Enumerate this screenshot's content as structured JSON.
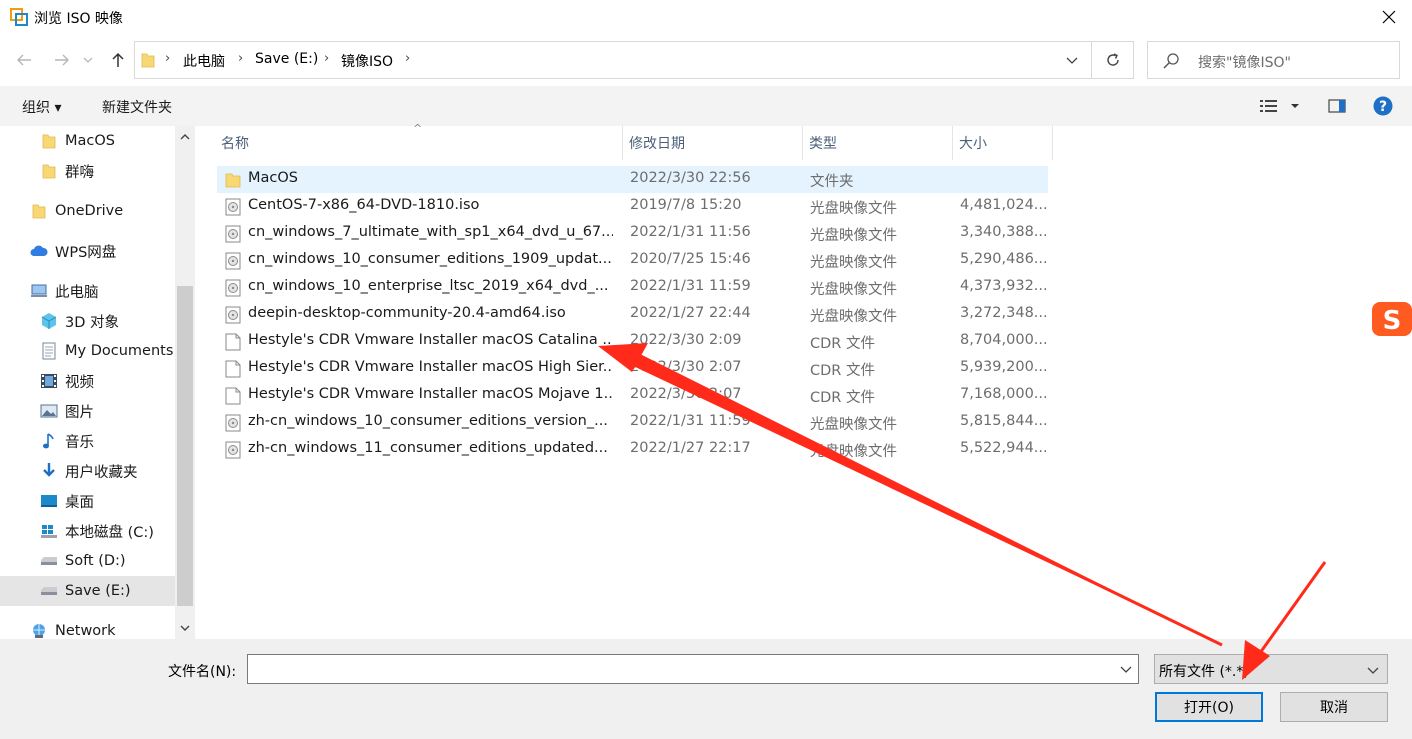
{
  "window": {
    "title": "浏览 ISO 映像"
  },
  "address": {
    "crumbs": [
      "此电脑",
      "Save (E:)",
      "镜像ISO"
    ]
  },
  "search": {
    "placeholder": "搜索\"镜像ISO\""
  },
  "toolbar": {
    "organize": "组织 ▾",
    "new_folder": "新建文件夹"
  },
  "nav": {
    "items": [
      {
        "label": "MacOS",
        "icon": "folder-icon"
      },
      {
        "label": "群嗨",
        "icon": "folder-icon"
      },
      {
        "label": "OneDrive",
        "icon": "folder-icon"
      },
      {
        "label": "WPS网盘",
        "icon": "cloud-icon"
      },
      {
        "label": "此电脑",
        "icon": "computer-icon"
      },
      {
        "label": "3D 对象",
        "icon": "cube-icon"
      },
      {
        "label": "My Documents",
        "icon": "document-icon"
      },
      {
        "label": "视频",
        "icon": "film-icon"
      },
      {
        "label": "图片",
        "icon": "picture-icon"
      },
      {
        "label": "音乐",
        "icon": "music-icon"
      },
      {
        "label": "用户收藏夹",
        "icon": "download-arrow-icon"
      },
      {
        "label": "桌面",
        "icon": "desktop-icon"
      },
      {
        "label": "本地磁盘 (C:)",
        "icon": "windows-drive-icon"
      },
      {
        "label": "Soft (D:)",
        "icon": "drive-icon"
      },
      {
        "label": "Save (E:)",
        "icon": "drive-icon"
      },
      {
        "label": "Network",
        "icon": "network-icon"
      }
    ]
  },
  "columns": {
    "name": "名称",
    "date": "修改日期",
    "type": "类型",
    "size": "大小"
  },
  "files": [
    {
      "name": "MacOS",
      "date": "2022/3/30 22:56",
      "type": "文件夹",
      "size": "",
      "icon": "folder-icon"
    },
    {
      "name": "CentOS-7-x86_64-DVD-1810.iso",
      "date": "2019/7/8 15:20",
      "type": "光盘映像文件",
      "size": "4,481,024...",
      "icon": "disc-image-icon"
    },
    {
      "name": "cn_windows_7_ultimate_with_sp1_x64_dvd_u_67...",
      "date": "2022/1/31 11:56",
      "type": "光盘映像文件",
      "size": "3,340,388...",
      "icon": "disc-image-icon"
    },
    {
      "name": "cn_windows_10_consumer_editions_1909_updat...",
      "date": "2020/7/25 15:46",
      "type": "光盘映像文件",
      "size": "5,290,486...",
      "icon": "disc-image-icon"
    },
    {
      "name": "cn_windows_10_enterprise_ltsc_2019_x64_dvd_...",
      "date": "2022/1/31 11:59",
      "type": "光盘映像文件",
      "size": "4,373,932...",
      "icon": "disc-image-icon"
    },
    {
      "name": "deepin-desktop-community-20.4-amd64.iso",
      "date": "2022/1/27 22:44",
      "type": "光盘映像文件",
      "size": "3,272,348...",
      "icon": "disc-image-icon"
    },
    {
      "name": "Hestyle's CDR Vmware Installer macOS Catalina ...",
      "date": "2022/3/30 2:09",
      "type": "CDR 文件",
      "size": "8,704,000...",
      "icon": "file-icon"
    },
    {
      "name": "Hestyle's CDR Vmware Installer macOS High Sier...",
      "date": "2022/3/30 2:07",
      "type": "CDR 文件",
      "size": "5,939,200...",
      "icon": "file-icon"
    },
    {
      "name": "Hestyle's CDR Vmware Installer macOS Mojave 1...",
      "date": "2022/3/30 2:07",
      "type": "CDR 文件",
      "size": "7,168,000...",
      "icon": "file-icon"
    },
    {
      "name": "zh-cn_windows_10_consumer_editions_version_...",
      "date": "2022/1/31 11:59",
      "type": "光盘映像文件",
      "size": "5,815,844...",
      "icon": "disc-image-icon"
    },
    {
      "name": "zh-cn_windows_11_consumer_editions_updated...",
      "date": "2022/1/27 22:17",
      "type": "光盘映像文件",
      "size": "5,522,944...",
      "icon": "disc-image-icon"
    }
  ],
  "bottom": {
    "filename_label": "文件名(N):",
    "filename_value": "",
    "filter_value": "所有文件 (*.*)",
    "open_label": "打开(O)",
    "cancel_label": "取消"
  },
  "colors": {
    "accent": "#0078d7",
    "selection": "#e5f3ff",
    "arrow": "#ff2a1a",
    "folder": "#f8d775"
  }
}
